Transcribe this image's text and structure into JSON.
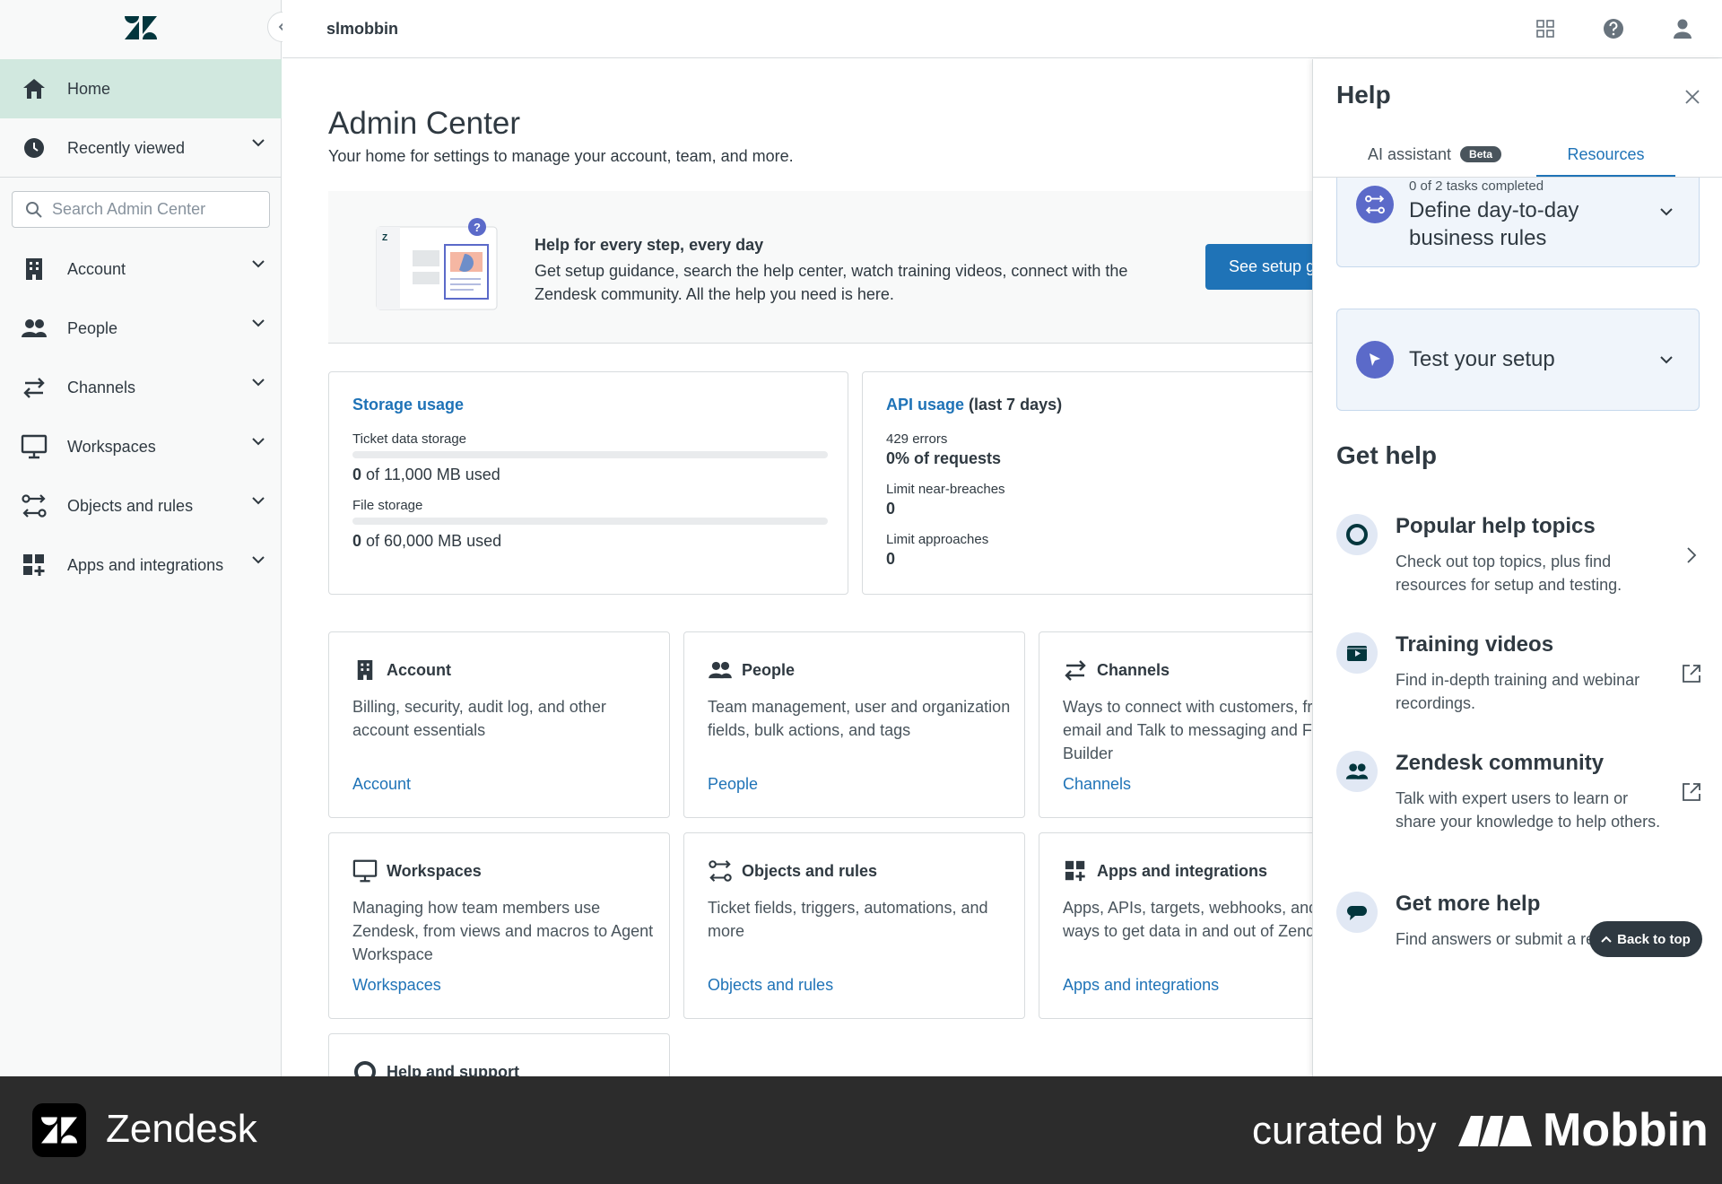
{
  "app": {
    "brand": "slmobbin"
  },
  "sidebar": {
    "search_placeholder": "Search Admin Center",
    "items": [
      {
        "label": "Home",
        "icon": "home-icon"
      },
      {
        "label": "Recently viewed",
        "icon": "clock-icon"
      },
      {
        "label": "Account",
        "icon": "building-icon"
      },
      {
        "label": "People",
        "icon": "people-icon"
      },
      {
        "label": "Channels",
        "icon": "arrows-icon"
      },
      {
        "label": "Workspaces",
        "icon": "monitor-icon"
      },
      {
        "label": "Objects and rules",
        "icon": "rules-icon"
      },
      {
        "label": "Apps and integrations",
        "icon": "apps-icon"
      }
    ]
  },
  "main": {
    "title": "Admin Center",
    "subtitle": "Your home for settings to manage your account, team, and more.",
    "banner": {
      "title": "Help for every step, every day",
      "text": "Get setup guidance, search the help center, watch training videos, connect with the Zendesk community. All the help you need is here.",
      "button": "See setup guides"
    },
    "storage": {
      "title": "Storage usage",
      "ticket_label": "Ticket data storage",
      "ticket_used": "0",
      "ticket_total": " of 11,000 MB used",
      "ticket_fraction": 0,
      "file_label": "File storage",
      "file_used": "0",
      "file_total": " of 60,000 MB used",
      "file_fraction": 0
    },
    "api": {
      "title": "API usage",
      "period": "(last 7 days)",
      "errors_label": "429 errors",
      "errors_value": "0% of requests",
      "breaches_label": "Limit near-breaches",
      "breaches_value": "0",
      "approaches_label": "Limit approaches",
      "approaches_value": "0"
    },
    "categories": [
      {
        "title": "Account",
        "desc": "Billing, security, audit log, and other account essentials",
        "link": "Account"
      },
      {
        "title": "People",
        "desc": "Team management, user and organization fields, bulk actions, and tags",
        "link": "People"
      },
      {
        "title": "Channels",
        "desc": "Ways to connect with customers, from email and Talk to messaging and Flow Builder",
        "link": "Channels"
      },
      {
        "title": "Workspaces",
        "desc": "Managing how team members use Zendesk, from views and macros to Agent Workspace",
        "link": "Workspaces"
      },
      {
        "title": "Objects and rules",
        "desc": "Ticket fields, triggers, automations, and more",
        "link": "Objects and rules"
      },
      {
        "title": "Apps and integrations",
        "desc": "Apps, APIs, targets, webhooks, and other ways to get data in and out of Zendesk",
        "link": "Apps and integrations"
      },
      {
        "title": "Help and support"
      }
    ]
  },
  "help": {
    "title": "Help",
    "tabs": {
      "ai": "AI assistant",
      "beta": "Beta",
      "resources": "Resources"
    },
    "task1": {
      "progress": "0 of 2 tasks completed",
      "title": "Define day-to-day business rules"
    },
    "task2": {
      "title": "Test your setup"
    },
    "get_help": "Get help",
    "resources": [
      {
        "title": "Popular help topics",
        "desc": "Check out top topics, plus find resources for setup and testing."
      },
      {
        "title": "Training videos",
        "desc": "Find in-depth training and webinar recordings."
      },
      {
        "title": "Zendesk community",
        "desc": "Talk with expert users to learn or share your knowledge to help others."
      },
      {
        "title": "Get more help",
        "desc": "Find answers or submit a request."
      }
    ],
    "back_to_top": "Back to top"
  },
  "footer": {
    "brand": "Zendesk",
    "curated": "curated by",
    "mobbin": "Mobbin"
  }
}
